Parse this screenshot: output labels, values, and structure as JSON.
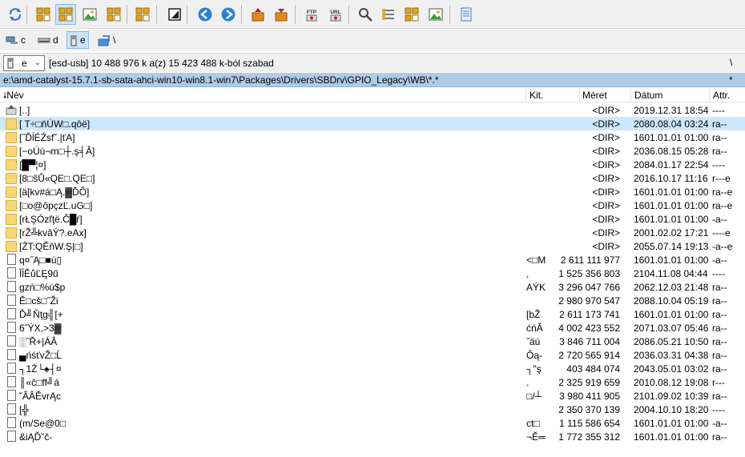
{
  "toolbar": {
    "buttons": [
      {
        "name": "refresh-icon",
        "color": "#2f7fd1"
      },
      {
        "name": "brief-view-icon",
        "color": "#e0a420"
      },
      {
        "name": "full-view-icon",
        "color": "#e0a420",
        "active": true
      },
      {
        "name": "thumbnail-view-icon",
        "color": "#3b9c3b"
      },
      {
        "name": "tree-view-icon",
        "color": "#e0a420"
      },
      {
        "name": "compare-dirs-icon",
        "color": "#e0a420"
      },
      {
        "name": "hidden-files-icon",
        "color": "#222222"
      },
      {
        "name": "back-icon",
        "color": "#2f7fd1"
      },
      {
        "name": "forward-icon",
        "color": "#2f7fd1"
      },
      {
        "name": "pack-icon",
        "color": "#e08a20"
      },
      {
        "name": "unpack-icon",
        "color": "#e08a20"
      },
      {
        "name": "ftp-icon",
        "color": "#c02020",
        "label": "FTP"
      },
      {
        "name": "url-icon",
        "color": "#c02020",
        "label": "URL"
      },
      {
        "name": "search-icon",
        "color": "#444444"
      },
      {
        "name": "multi-rename-icon",
        "color": "#e0a420"
      },
      {
        "name": "sync-dirs-icon",
        "color": "#e0a420"
      },
      {
        "name": "file-editor-icon",
        "color": "#3b9c3b"
      },
      {
        "name": "notepad-icon",
        "color": "#4a7fc0"
      }
    ]
  },
  "drives": [
    {
      "letter": "c",
      "icon": "network-drive-icon",
      "active": false
    },
    {
      "letter": "d",
      "icon": "disk-drive-icon",
      "active": false
    },
    {
      "letter": "e",
      "icon": "usb-drive-icon",
      "active": true
    },
    {
      "letter": "\\",
      "icon": "root-folder-icon",
      "active": false
    }
  ],
  "infobar": {
    "drive_letter": "e",
    "free_text": "[esd-usb]  10 488 976 k a(z) 15 423 488 k-ból szabad",
    "root_label": "\\"
  },
  "pathbar": {
    "path": "e:\\amd-catalyst-15.7.1-sb-sata-ahci-win10-win8.1-win7\\Packages\\Drivers\\SBDrv\\GPIO_Legacy\\WB\\*.*",
    "star": "*"
  },
  "columns": {
    "name": "Név",
    "ext": "Kit.",
    "size": "Méret",
    "date": "Dátum",
    "attr": "Attr."
  },
  "files": [
    {
      "type": "up",
      "name": "[..]",
      "ext": "",
      "size": "<DIR>",
      "date": "2019.12.31 18:54",
      "attr": "----"
    },
    {
      "type": "dir",
      "name": "[ T÷□ňÚW□.qôë]",
      "ext": "",
      "size": "<DIR>",
      "date": "2080.08.04 03:24",
      "attr": "ra--",
      "selected": true
    },
    {
      "type": "dir",
      "name": "[˝ĎĺÉŹsf˘.|ťA]",
      "ext": "",
      "size": "<DIR>",
      "date": "1601.01.01 01:00",
      "attr": "ra--"
    },
    {
      "type": "dir",
      "name": "[−oÚú¬m□┼.ş╡Â]",
      "ext": "",
      "size": "<DIR>",
      "date": "2036.08.15 05:28",
      "attr": "ra--"
    },
    {
      "type": "dir",
      "name": "[█▀¦¤]",
      "ext": "",
      "size": "<DIR>",
      "date": "2084.01.17 22:54",
      "attr": "----"
    },
    {
      "type": "dir",
      "name": "[8□ŝŮ«QE□.QE□]",
      "ext": "",
      "size": "<DIR>",
      "date": "2016.10.17 11:16",
      "attr": "r---e"
    },
    {
      "type": "dir",
      "name": "[ä[kv#á□Ą.▓ĎÔ]",
      "ext": "",
      "size": "<DIR>",
      "date": "1601.01.01 01:00",
      "attr": "ra--e"
    },
    {
      "type": "dir",
      "name": "[□o@ôpçzĽ.uG□]",
      "ext": "",
      "size": "<DIR>",
      "date": "1601.01.01 01:00",
      "attr": "ra--e"
    },
    {
      "type": "dir",
      "name": "[rŁŞÓzľţë.Č█ŕ]",
      "ext": "",
      "size": "<DIR>",
      "date": "1601.01.01 01:00",
      "attr": "-a--"
    },
    {
      "type": "dir",
      "name": "[rŽ╩kvăÝ?.eAx]",
      "ext": "",
      "size": "<DIR>",
      "date": "2001.02.02 17:21",
      "attr": "----e"
    },
    {
      "type": "dir",
      "name": "[ŹT:QĚňW.Ş|□]",
      "ext": "",
      "size": "<DIR>",
      "date": "2055.07.14 19:13",
      "attr": "-a--e"
    },
    {
      "type": "file",
      "name": "q¤˝Ą□■ú▯",
      "ext": "<□M",
      "size": "2 611 111 977",
      "date": "1601.01.01 01:00",
      "attr": "-a--"
    },
    {
      "type": "file",
      "name": "ÎĺĚůĽĘ9ű",
      "ext": ",",
      "size": "1 525 356 803",
      "date": "2104.11.08 04:44",
      "attr": "----"
    },
    {
      "type": "file",
      "name": "gzń□%ú$p",
      "ext": "AÝK",
      "size": "3 296 047 766",
      "date": "2062.12.03 21:48",
      "attr": "ra--"
    },
    {
      "type": "file",
      "name": "Ě□cš□˝Ži",
      "ext": "",
      "size": "2 980 970 547",
      "date": "2088.10.04 05:19",
      "attr": "ra--"
    },
    {
      "type": "file",
      "name": "Ď╝Ňţg╣[+",
      "ext": "[bŽ",
      "size": "2 611 173 741",
      "date": "1601.01.01 01:00",
      "attr": "ra--"
    },
    {
      "type": "file",
      "name": "6˝ÝX,>3▓",
      "ext": "ćńĂ",
      "size": "4 002 423 552",
      "date": "2071.03.07 05:46",
      "attr": "ra--"
    },
    {
      "type": "file",
      "name": "░˝Ř+|ÁÂ",
      "ext": "˝äú",
      "size": "3 846 711 004",
      "date": "2086.05.21 10:50",
      "attr": "ra--"
    },
    {
      "type": "file",
      "name": "▄ńśťvŽ□Ĺ",
      "ext": "Ôą-",
      "size": "2 720 565 914",
      "date": "2036.03.31 04:38",
      "attr": "ra--"
    },
    {
      "type": "file",
      "name": "┐1Ź└♠┤¤",
      "ext": "┐\"ş",
      "size": "403 484 074",
      "date": "2043.05.01 03:02",
      "attr": "ra--"
    },
    {
      "type": "file",
      "name": "║«č□ff╝á",
      "ext": ".",
      "size": "2 325 919 659",
      "date": "2010.08.12 19:08",
      "attr": "r---"
    },
    {
      "type": "file",
      "name": "˘ÂÂĚvrĄc",
      "ext": "□/┴",
      "size": "3 980 411 905",
      "date": "2101.09.02 10:39",
      "attr": "ra--"
    },
    {
      "type": "file",
      "name": "[╬",
      "ext": "",
      "size": "2 350 370 139",
      "date": "2004.10.10 18:20",
      "attr": "----"
    },
    {
      "type": "file",
      "name": "(m/Se@0□",
      "ext": "ct□",
      "size": "1 115 586 654",
      "date": "1601.01.01 01:00",
      "attr": "-a--"
    },
    {
      "type": "file",
      "name": "&iĄĎ˘č-",
      "ext": "¬Ě═",
      "size": "1 772 355 312",
      "date": "1601.01.01 01:00",
      "attr": "ra--"
    }
  ]
}
